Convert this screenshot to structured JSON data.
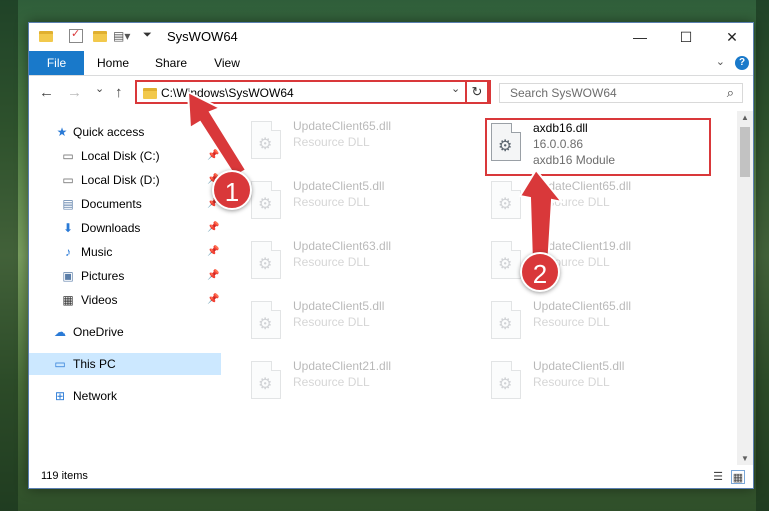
{
  "window": {
    "title": "SysWOW64",
    "minimize": "—",
    "maximize": "☐",
    "close": "✕"
  },
  "ribbon": {
    "tabs": [
      {
        "label": "File"
      },
      {
        "label": "Home"
      },
      {
        "label": "Share"
      },
      {
        "label": "View"
      }
    ],
    "help": "?",
    "expand": "⌄"
  },
  "nav": {
    "back": "←",
    "forward": "→",
    "recent": "⌄",
    "up": "↑",
    "address": "C:\\Windows\\SysWOW64",
    "address_dropdown": "⌄",
    "refresh": "↻",
    "search_placeholder": "Search SysWOW64"
  },
  "sidebar": {
    "items": [
      {
        "label": "Quick access",
        "icon": "star-icon"
      },
      {
        "label": "Local Disk (C:)",
        "icon": "drive-icon",
        "pinned": true
      },
      {
        "label": "Local Disk (D:)",
        "icon": "drive-icon",
        "pinned": true
      },
      {
        "label": "Documents",
        "icon": "documents-icon",
        "pinned": true
      },
      {
        "label": "Downloads",
        "icon": "download-icon",
        "pinned": true
      },
      {
        "label": "Music",
        "icon": "music-icon",
        "pinned": true
      },
      {
        "label": "Pictures",
        "icon": "pictures-icon",
        "pinned": true
      },
      {
        "label": "Videos",
        "icon": "videos-icon",
        "pinned": true
      },
      {
        "label": "OneDrive",
        "icon": "cloud-icon"
      },
      {
        "label": "This PC",
        "icon": "computer-icon",
        "selected": true
      },
      {
        "label": "Network",
        "icon": "network-icon"
      }
    ]
  },
  "files": [
    {
      "name": "UpdateClient65.dll",
      "line1": "Resource DLL",
      "line2": "",
      "faded": true
    },
    {
      "name": "axdb16.dll",
      "line1": "16.0.0.86",
      "line2": "axdb16 Module",
      "faded": false
    },
    {
      "name": "UpdateClient5.dll",
      "line1": "Resource DLL",
      "line2": "",
      "faded": true
    },
    {
      "name": "UpdateClient65.dll",
      "line1": "Resource DLL",
      "line2": "",
      "faded": true
    },
    {
      "name": "UpdateClient63.dll",
      "line1": "Resource DLL",
      "line2": "",
      "faded": true
    },
    {
      "name": "UpdateClient19.dll",
      "line1": "Resource DLL",
      "line2": "",
      "faded": true
    },
    {
      "name": "UpdateClient5.dll",
      "line1": "Resource DLL",
      "line2": "",
      "faded": true
    },
    {
      "name": "UpdateClient65.dll",
      "line1": "Resource DLL",
      "line2": "",
      "faded": true
    },
    {
      "name": "UpdateClient21.dll",
      "line1": "Resource DLL",
      "line2": "",
      "faded": true
    },
    {
      "name": "UpdateClient5.dll",
      "line1": "Resource DLL",
      "line2": "",
      "faded": true
    }
  ],
  "status": {
    "items": "119 items"
  },
  "annotations": {
    "step1": "1",
    "step2": "2",
    "color": "#d9383a"
  }
}
